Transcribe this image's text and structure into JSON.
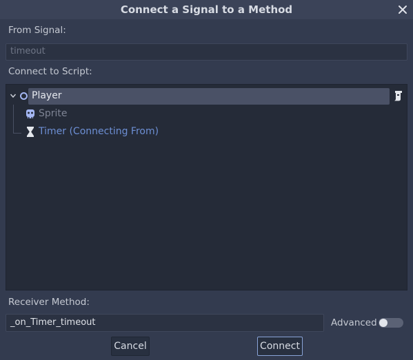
{
  "dialog": {
    "title": "Connect a Signal to a Method",
    "close_icon": "close-icon"
  },
  "from_signal": {
    "label": "From Signal:",
    "value": "timeout"
  },
  "connect_to_script": {
    "label": "Connect to Script:"
  },
  "tree": {
    "player": {
      "label": "Player",
      "icon": "node2d-icon",
      "selected": true,
      "expanded": true
    },
    "sprite": {
      "label": "Sprite",
      "icon": "sprite-icon"
    },
    "timer": {
      "label": "Timer (Connecting From)",
      "icon": "timer-icon"
    }
  },
  "receiver": {
    "label": "Receiver Method:",
    "value": "_on_Timer_timeout"
  },
  "advanced": {
    "label": "Advanced",
    "enabled": false
  },
  "buttons": {
    "cancel": "Cancel",
    "connect": "Connect"
  },
  "colors": {
    "accent": "#8aa4d8",
    "connecting_from": "#6d8fd4",
    "node2d": "#a5b7f3"
  }
}
